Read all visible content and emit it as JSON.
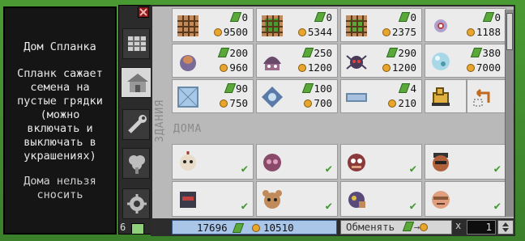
{
  "tooltip": {
    "title": "Дом Спланка",
    "description": "Спланк сажает\nсемена на\nпустые грядки\n(можно\nвключать и\nвыключать в\nукрашениях)",
    "warning": "Дома нельзя\nсносить"
  },
  "side_tabs": [
    {
      "icon": "farm-icon"
    },
    {
      "icon": "house-icon",
      "active": true
    },
    {
      "icon": "tools-icon"
    },
    {
      "icon": "tree-icon"
    },
    {
      "icon": "gear-icon"
    }
  ],
  "labels": {
    "buildings": "ЗДАНИЯ",
    "homes": "ДОМА"
  },
  "buildings": [
    {
      "icon": "fence-grid-icon",
      "gems": "0",
      "coins": "9500"
    },
    {
      "icon": "fence-grid-icon",
      "gems": "0",
      "coins": "5344"
    },
    {
      "icon": "fence-grid-icon",
      "gems": "0",
      "coins": "2375"
    },
    {
      "icon": "snail-icon",
      "gems": "0",
      "coins": "1188"
    },
    {
      "icon": "sack-icon",
      "gems": "200",
      "coins": "960"
    },
    {
      "icon": "helmet-icon",
      "gems": "250",
      "coins": "1200"
    },
    {
      "icon": "spider-icon",
      "gems": "290",
      "coins": "1200"
    },
    {
      "icon": "bubble-icon",
      "gems": "380",
      "coins": "7000"
    },
    {
      "icon": "window-icon",
      "gems": "90",
      "coins": "750"
    },
    {
      "icon": "portal-icon",
      "gems": "100",
      "coins": "700"
    },
    {
      "icon": "bench-icon",
      "gems": "4",
      "coins": "210"
    },
    {
      "icon": "crane-icon",
      "gems": "",
      "coins": ""
    },
    {
      "icon": "move-arrow-icon",
      "gems": "",
      "coins": ""
    }
  ],
  "homes": [
    {
      "icon": "face-icon"
    },
    {
      "icon": "face-icon"
    },
    {
      "icon": "face-icon"
    },
    {
      "icon": "face-icon"
    },
    {
      "icon": "face-icon"
    },
    {
      "icon": "face-icon"
    },
    {
      "icon": "face-icon"
    },
    {
      "icon": "face-icon"
    }
  ],
  "bottom": {
    "gems": "17696",
    "coins": "10510",
    "exchange": "Обменять",
    "multiplier": "x",
    "quantity": "1",
    "left_count": "6"
  }
}
